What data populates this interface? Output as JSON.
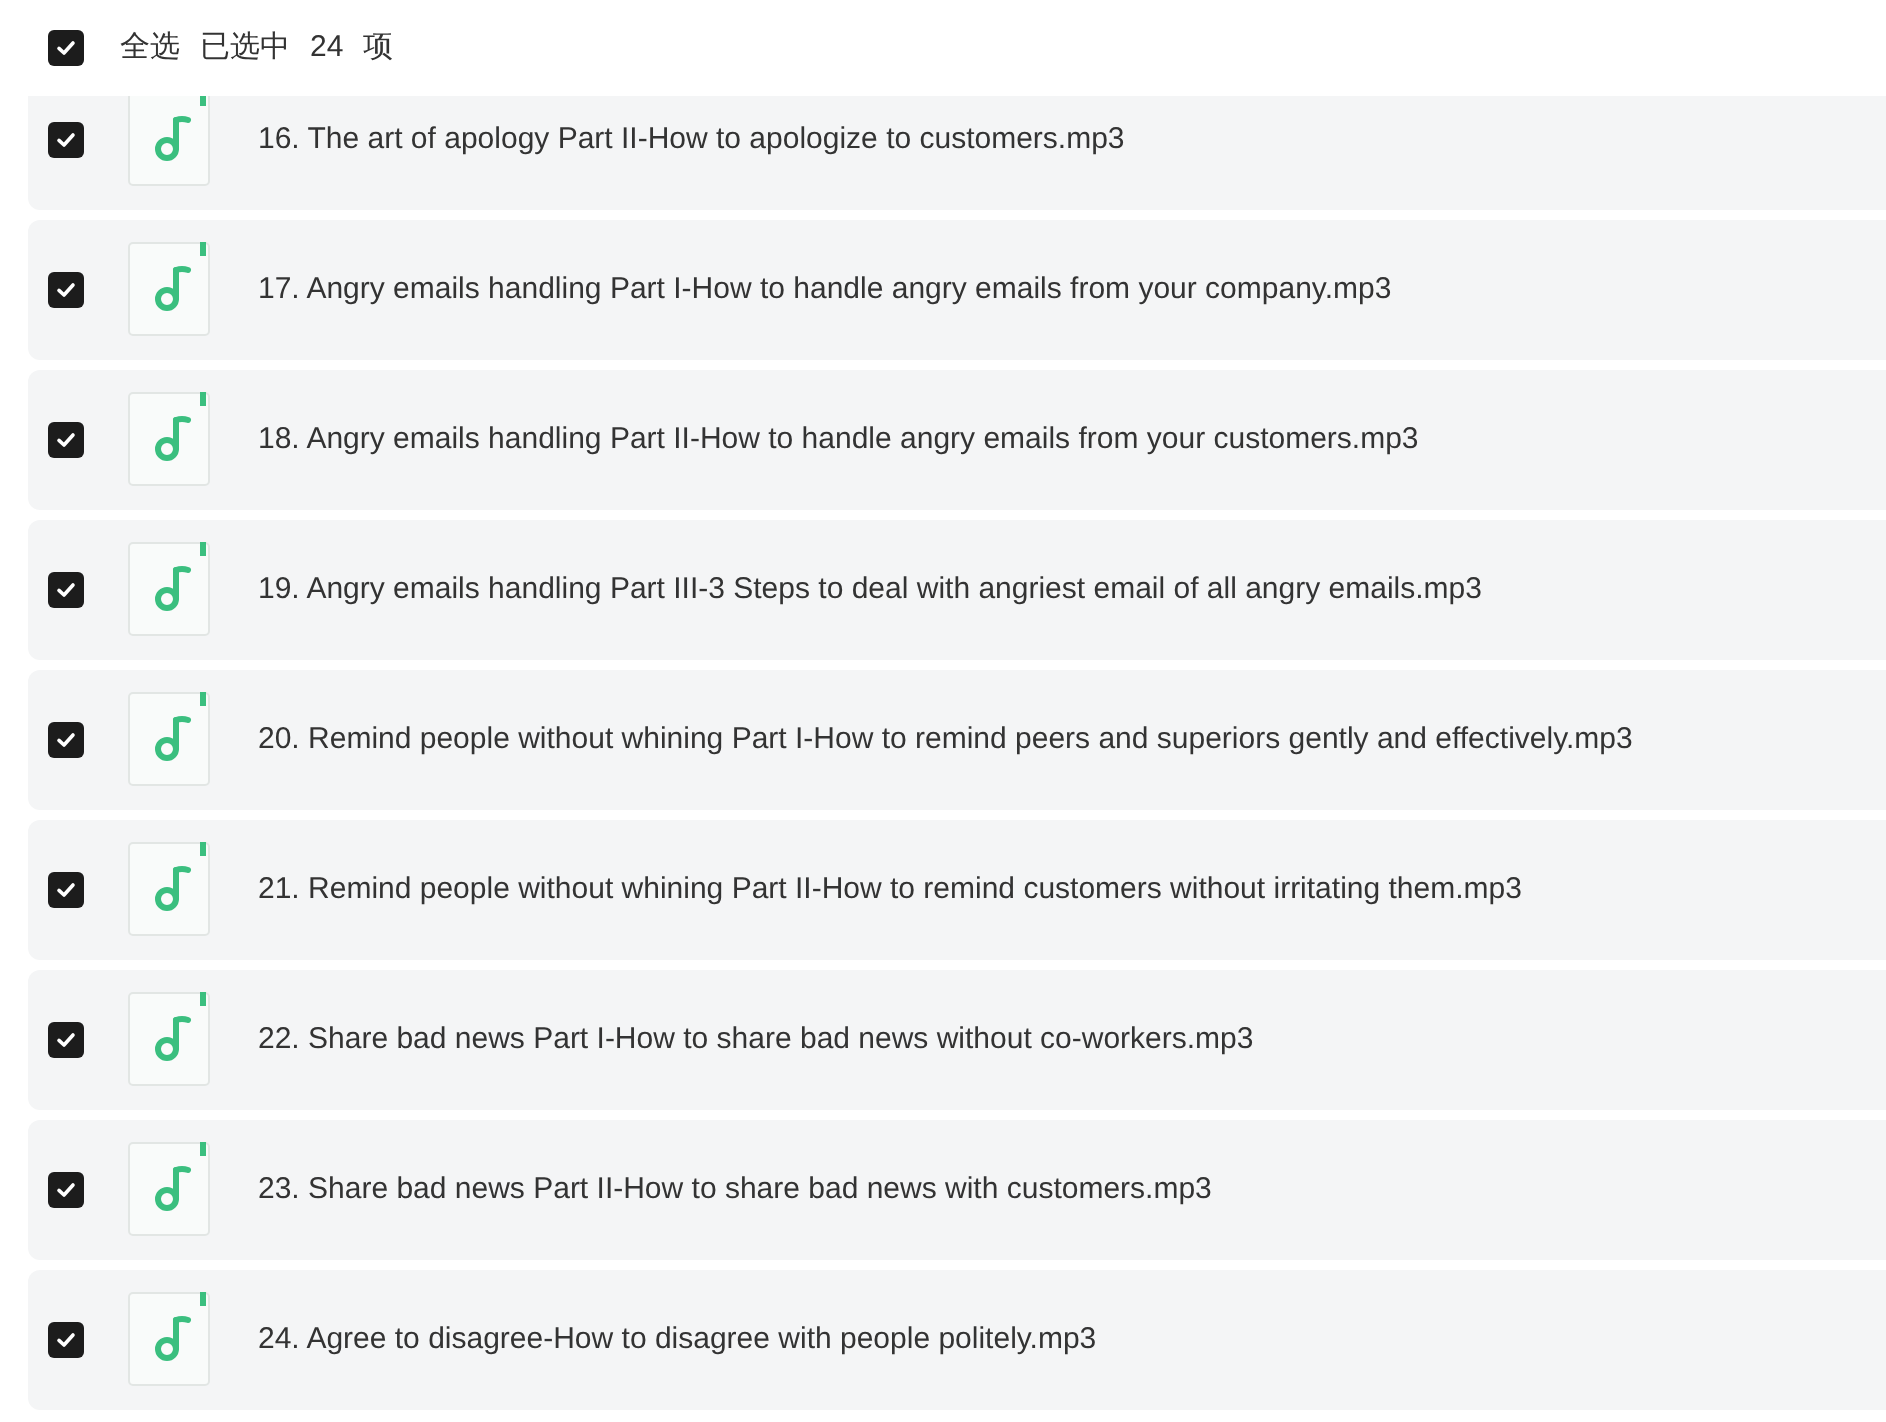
{
  "header": {
    "select_all": {
      "label": "全选",
      "checked": true
    },
    "selection_label": "已选中",
    "selection_count": "24",
    "selection_unit": "项"
  },
  "files": [
    {
      "name": "16. The art of apology Part II-How to apologize to customers.mp3",
      "checked": true
    },
    {
      "name": "17. Angry emails handling Part I-How to handle angry emails from your company.mp3",
      "checked": true
    },
    {
      "name": "18. Angry emails handling Part II-How to handle angry emails from your customers.mp3",
      "checked": true
    },
    {
      "name": "19. Angry emails handling Part III-3 Steps to deal with angriest email of all angry emails.mp3",
      "checked": true
    },
    {
      "name": "20. Remind people without whining Part I-How to remind peers and superiors gently and effectively.mp3",
      "checked": true
    },
    {
      "name": "21. Remind people without whining Part II-How to remind customers without irritating them.mp3",
      "checked": true
    },
    {
      "name": "22. Share bad news Part I-How to share bad news without co-workers.mp3",
      "checked": true
    },
    {
      "name": "23. Share bad news Part II-How to share bad news with customers.mp3",
      "checked": true
    },
    {
      "name": "24. Agree to disagree-How to disagree with people politely.mp3",
      "checked": true
    }
  ]
}
